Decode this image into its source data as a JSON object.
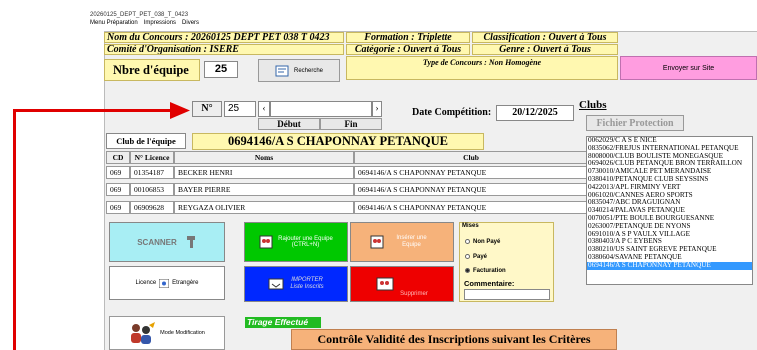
{
  "window": {
    "title": "20260125_DEPT_PET_038_T_0423",
    "menu": [
      "Menu Préparation",
      "Impressions",
      "Divers"
    ]
  },
  "header": {
    "concours": "Nom du Concours : 20260125 DEPT PET 038  T  0423",
    "comite": "Comité d'Organisation : ISERE",
    "formation": "Formation : Triplette",
    "classification": "Classification : Ouvert à Tous",
    "categorie": "Catégorie : Ouvert à Tous",
    "genre": "Genre : Ouvert à Tous",
    "type": "Type de Concours : Non Homogène",
    "nbre_label": "Nbre d'équipe",
    "nbre_value": "25",
    "recherche": "Recherche",
    "envoyer": "Envoyer sur Site"
  },
  "nav": {
    "n_label": "N°",
    "n_value": "25",
    "prev": "‹",
    "next": "›",
    "debut": "Début",
    "fin": "Fin",
    "date_label": "Date Compétition:",
    "date_value": "20/12/2025"
  },
  "team": {
    "club_label": "Club de l'équipe",
    "club_name": "0694146/A S  CHAPONNAY PETANQUE",
    "columns": [
      "CD",
      "N° Licence",
      "Noms",
      "Club"
    ],
    "players": [
      {
        "cd": "069",
        "licence": "01354187",
        "nom": "BECKER HENRI",
        "club": "0694146/A S  CHAPONNAY PETANQUE"
      },
      {
        "cd": "069",
        "licence": "00106853",
        "nom": "BAYER PIERRE",
        "club": "0694146/A S  CHAPONNAY PETANQUE"
      },
      {
        "cd": "069",
        "licence": "06909628",
        "nom": "REYGAZA OLIVIER",
        "club": "0694146/A S  CHAPONNAY PETANQUE"
      }
    ]
  },
  "actions": {
    "scanner": "SCANNER",
    "rajouter": "Rajouter une Equipe",
    "rajouter_sub": "(CTRL+N)",
    "inserer": "Insérer une Equipe",
    "licence": "Licence",
    "etrangere": "Etrangère",
    "importer": "IMPORTER",
    "liste": "Liste Inscrits",
    "supprimer": "Supprimer",
    "mode": "Mode Modification",
    "tirage": "Tirage Effectué",
    "controle": "Contrôle Validité des Inscriptions suivant les Critères"
  },
  "mises": {
    "title": "Mises",
    "options": [
      "Non Payé",
      "Payé",
      "Facturation"
    ],
    "commentaire": "Commentaire:"
  },
  "clubs": {
    "title": "Clubs",
    "fichier": "Fichier Protection",
    "items": [
      "0062029/C A S E  NICE",
      "0835062/FREJUS INTERNATIONAL PETANQUE",
      "8008000/CLUB BOULISTE MONEGASQUE",
      "0694026/CLUB PETANQUE BRON TERRAILLON",
      "0730010/AMICALE PET MERANDAISE",
      "0380410/PETANQUE CLUB SEYSSINS",
      "0422013/APL FIRMINY VERT",
      "0061020/CANNES AERO SPORTS",
      "0835047/ABC DRAGUIGNAN",
      "0340214/PALAVAS PETANQUE",
      "0070051/PTE BOULE BOURGUESANNE",
      "0263007/PETANQUE DE NYONS",
      "0691010/A S P  VAULX VILLAGE",
      "0380403/A P C  EYBENS",
      "0380210/US SAINT EGREVE PETANQUE",
      "0380604/SAVANE PETANQUE",
      "0694146/A S  CHAPONNAY PETANQUE"
    ]
  }
}
